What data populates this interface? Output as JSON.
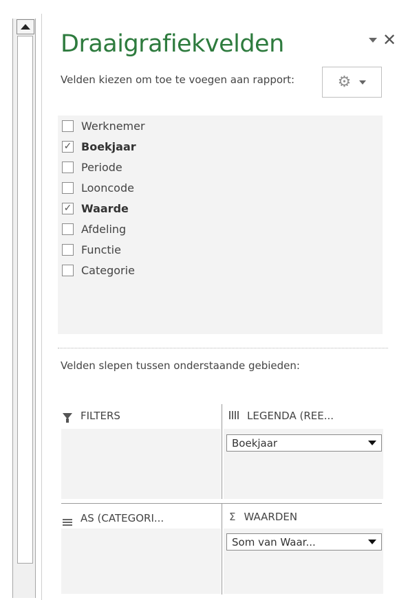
{
  "pane": {
    "title": "Draaigrafiekvelden",
    "close_glyph": "✕",
    "choose_label": "Velden kiezen om toe te voegen aan rapport:",
    "tools_icon": "⚙"
  },
  "fields": [
    {
      "label": "Werknemer",
      "checked": false
    },
    {
      "label": "Boekjaar",
      "checked": true
    },
    {
      "label": "Periode",
      "checked": false
    },
    {
      "label": "Looncode",
      "checked": false
    },
    {
      "label": "Waarde",
      "checked": true
    },
    {
      "label": "Afdeling",
      "checked": false
    },
    {
      "label": "Functie",
      "checked": false
    },
    {
      "label": "Categorie",
      "checked": false
    }
  ],
  "drag_label": "Velden slepen tussen onderstaande gebieden:",
  "areas": {
    "filters": {
      "label": "FILTERS",
      "icon": "filter-icon"
    },
    "legend": {
      "label": "LEGENDA (REE...",
      "icon": "legend-series-icon",
      "item": "Boekjaar"
    },
    "axis": {
      "label": "AS (CATEGORI...",
      "icon": "axis-categories-icon"
    },
    "values": {
      "label": "WAARDEN",
      "icon": "sigma-icon",
      "icon_glyph": "Σ",
      "item": "Som van Waar..."
    }
  },
  "check_glyph": "✓",
  "colors": {
    "title": "#2e7b3e",
    "area_bg": "#f3f3f3"
  }
}
